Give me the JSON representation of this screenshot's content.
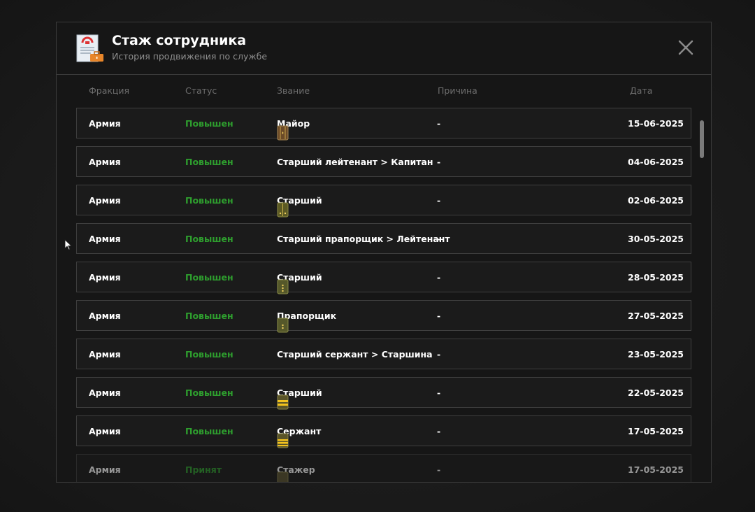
{
  "dialog": {
    "title": "Стаж сотрудника",
    "subtitle": "История продвижения по службе",
    "header_icon": "document-briefcase-icon",
    "close_icon": "close-icon"
  },
  "columns": {
    "faction": "Фракция",
    "status": "Статус",
    "rank": "Звание",
    "reason": "Причина",
    "date": "Дата"
  },
  "rows": [
    {
      "faction": "Армия",
      "status": "Повышен",
      "rank": "Майор",
      "rank_icon": "shoulder-board-major-icon",
      "reason": "-",
      "date": "15-06-2025"
    },
    {
      "faction": "Армия",
      "status": "Повышен",
      "rank": "Старший лейтенант > Капитан",
      "rank_icon": "",
      "reason": "-",
      "date": "04-06-2025"
    },
    {
      "faction": "Армия",
      "status": "Повышен",
      "rank": "Старший",
      "rank_icon": "shoulder-board-officer-icon",
      "reason": "-",
      "date": "02-06-2025"
    },
    {
      "faction": "Армия",
      "status": "Повышен",
      "rank": "Старший прапорщик > Лейтенант",
      "rank_icon": "",
      "reason": "-",
      "date": "30-05-2025"
    },
    {
      "faction": "Армия",
      "status": "Повышен",
      "rank": "Старший",
      "rank_icon": "shoulder-board-warrant-senior-icon",
      "reason": "-",
      "date": "28-05-2025"
    },
    {
      "faction": "Армия",
      "status": "Повышен",
      "rank": "Прапорщик",
      "rank_icon": "shoulder-board-warrant-icon",
      "reason": "-",
      "date": "27-05-2025"
    },
    {
      "faction": "Армия",
      "status": "Повышен",
      "rank": "Старший сержант > Старшина",
      "rank_icon": "",
      "reason": "-",
      "date": "23-05-2025"
    },
    {
      "faction": "Армия",
      "status": "Повышен",
      "rank": "Старший",
      "rank_icon": "shoulder-board-sergeant-senior-icon",
      "reason": "-",
      "date": "22-05-2025"
    },
    {
      "faction": "Армия",
      "status": "Повышен",
      "rank": "Сержант",
      "rank_icon": "shoulder-board-sergeant-icon",
      "reason": "-",
      "date": "17-05-2025"
    },
    {
      "faction": "Армия",
      "status": "Принят",
      "rank": "Стажер",
      "rank_icon": "shoulder-board-trainee-icon",
      "reason": "-",
      "date": "17-05-2025"
    }
  ],
  "colors": {
    "status_green": "#2e9e2e",
    "background": "#161616",
    "row_border": "#3f3f3f"
  }
}
